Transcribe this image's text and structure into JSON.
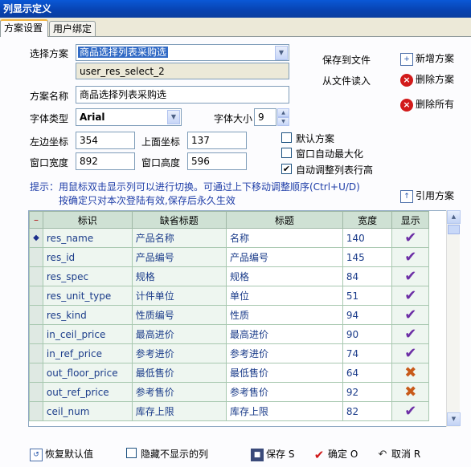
{
  "window": {
    "title": "列显示定义"
  },
  "tabs": [
    {
      "label": "方案设置"
    },
    {
      "label": "用户绑定"
    }
  ],
  "form": {
    "scheme_label": "选择方案",
    "scheme_value": "商品选择列表采购选",
    "scheme_id": "user_res_select_2",
    "name_label": "方案名称",
    "name_value": "商品选择列表采购选",
    "font_label": "字体类型",
    "font_value": "Arial",
    "size_label": "字体大小",
    "size_value": "9",
    "left_label": "左边坐标",
    "left_value": "354",
    "top_label": "上面坐标",
    "top_value": "137",
    "width_label": "窗口宽度",
    "width_value": "892",
    "height_label": "窗口高度",
    "height_value": "596"
  },
  "options": {
    "default_scheme": "默认方案",
    "auto_max": "窗口自动最大化",
    "auto_row_height": "自动调整列表行高"
  },
  "actions": {
    "save_to_file": "保存到文件",
    "load_from_file": "从文件读入",
    "add_scheme": "新增方案",
    "delete_scheme": "删除方案",
    "delete_all": "删除所有",
    "ref_scheme": "引用方案"
  },
  "hint": {
    "line1": "提示：用鼠标双击显示列可以进行切换。可通过上下移动调整顺序(Ctrl+U/D)",
    "line2": "按确定只对本次登陆有效,保存后永久生效"
  },
  "table": {
    "headers": {
      "ind": "–",
      "id": "标识",
      "default_title": "缺省标题",
      "title": "标题",
      "width": "宽度",
      "show": "显示"
    },
    "rows": [
      {
        "id": "res_name",
        "default_title": "产品名称",
        "title": "名称",
        "width": "140",
        "show": true
      },
      {
        "id": "res_id",
        "default_title": "产品编号",
        "title": "产品编号",
        "width": "145",
        "show": true
      },
      {
        "id": "res_spec",
        "default_title": "规格",
        "title": "规格",
        "width": "84",
        "show": true
      },
      {
        "id": "res_unit_type",
        "default_title": "计件单位",
        "title": "单位",
        "width": "51",
        "show": true
      },
      {
        "id": "res_kind",
        "default_title": "性质编号",
        "title": "性质",
        "width": "94",
        "show": true
      },
      {
        "id": "in_ceil_price",
        "default_title": "最高进价",
        "title": "最高进价",
        "width": "90",
        "show": true
      },
      {
        "id": "in_ref_price",
        "default_title": "参考进价",
        "title": "参考进价",
        "width": "74",
        "show": true
      },
      {
        "id": "out_floor_price",
        "default_title": "最低售价",
        "title": "最低售价",
        "width": "64",
        "show": false
      },
      {
        "id": "out_ref_price",
        "default_title": "参考售价",
        "title": "参考售价",
        "width": "92",
        "show": false
      },
      {
        "id": "ceil_num",
        "default_title": "库存上限",
        "title": "库存上限",
        "width": "82",
        "show": true
      }
    ]
  },
  "footer": {
    "restore": "恢复默认值",
    "hide_hidden": "隐藏不显示的列",
    "save": "保存 S",
    "ok": "确定 O",
    "cancel": "取消 R"
  },
  "icons": {
    "check": "✔",
    "cross": "✖",
    "current_row": "◆"
  }
}
